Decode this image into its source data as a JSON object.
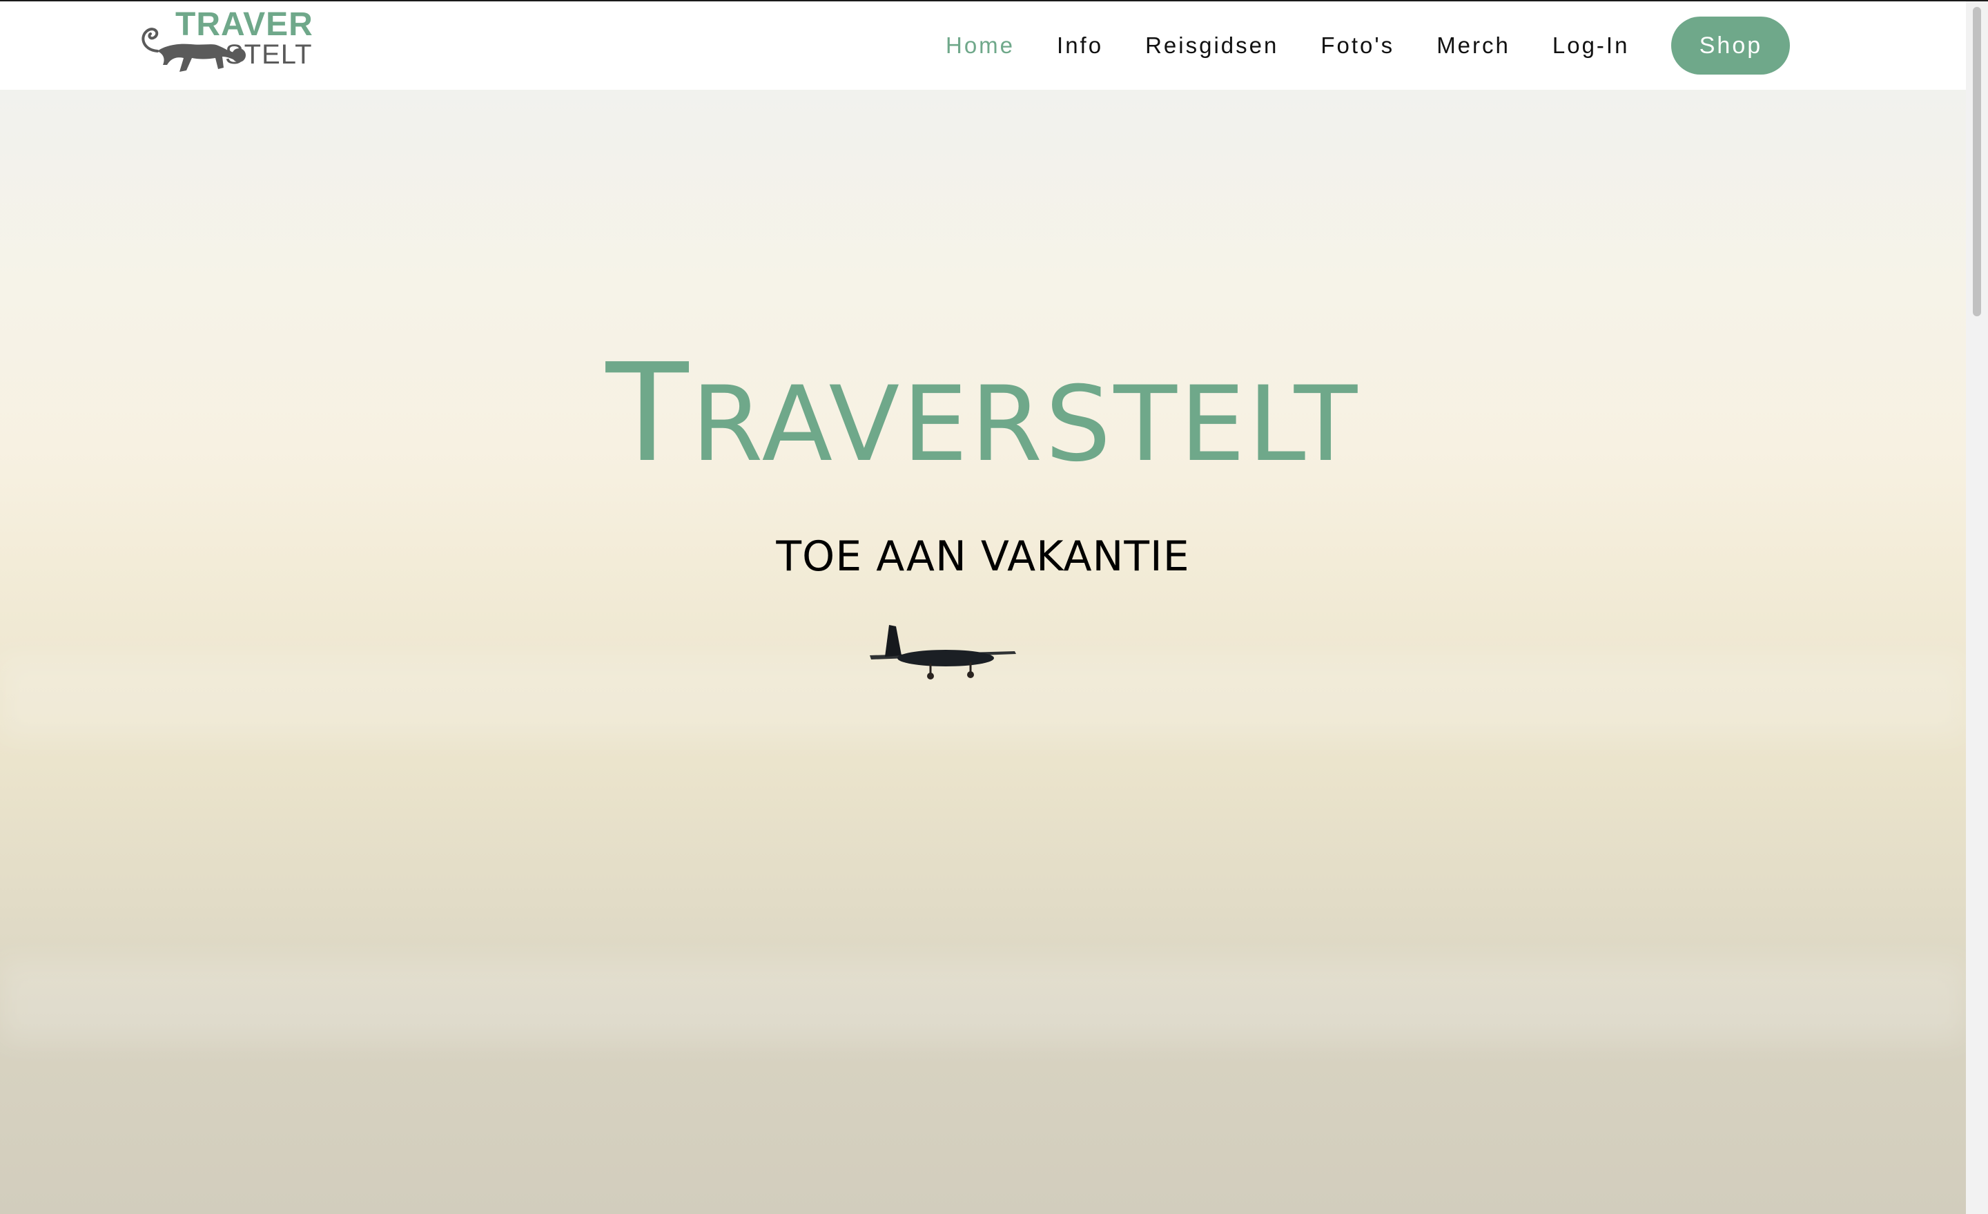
{
  "header": {
    "logo": {
      "top_word": "TRAVER",
      "bottom_word": "STELT",
      "icon": "monkey-icon"
    },
    "nav": [
      {
        "label": "Home",
        "active": true
      },
      {
        "label": "Info",
        "active": false
      },
      {
        "label": "Reisgidsen",
        "active": false
      },
      {
        "label": "Foto's",
        "active": false
      },
      {
        "label": "Merch",
        "active": false
      },
      {
        "label": "Log-In",
        "active": false
      }
    ],
    "shop_label": "Shop"
  },
  "hero": {
    "title_first": "T",
    "title_rest": "RAVERSTELT",
    "subtitle": "TOE AAN VAKANTIE",
    "plane_icon": "airplane-icon"
  },
  "colors": {
    "accent": "#6fa88a",
    "text": "#111111",
    "logo_gray": "#5a5a5a"
  }
}
